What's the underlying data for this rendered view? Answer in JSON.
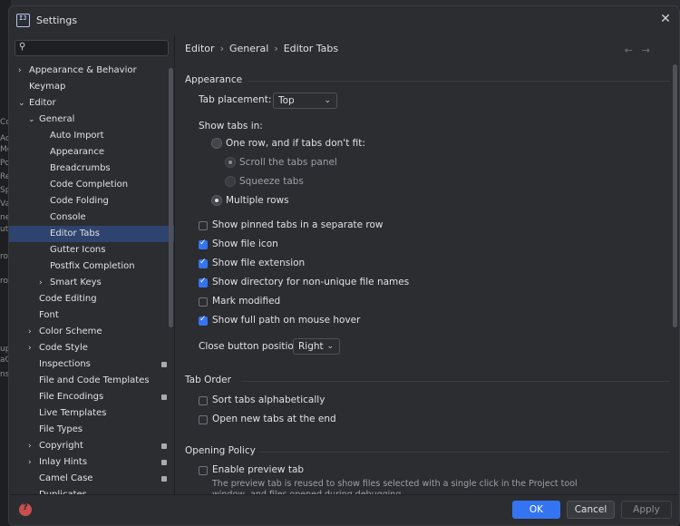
{
  "window": {
    "title": "Settings"
  },
  "background_fragments": [
    "Co",
    "Ac",
    "Mo",
    "Po",
    "Re",
    "Sp",
    "Va",
    "ne",
    "utr",
    "roi",
    "roi",
    "up",
    "aC",
    "ns"
  ],
  "sidebar": {
    "search_placeholder": "",
    "items": [
      {
        "label": "Appearance & Behavior",
        "arrow": "›",
        "indent": 0,
        "bold": true
      },
      {
        "label": "Keymap",
        "arrow": "",
        "indent": 0,
        "bold": true
      },
      {
        "label": "Editor",
        "arrow": "⌄",
        "indent": 0,
        "bold": true
      },
      {
        "label": "General",
        "arrow": "⌄",
        "indent": 1
      },
      {
        "label": "Auto Import",
        "arrow": "",
        "indent": 2
      },
      {
        "label": "Appearance",
        "arrow": "",
        "indent": 2
      },
      {
        "label": "Breadcrumbs",
        "arrow": "",
        "indent": 2
      },
      {
        "label": "Code Completion",
        "arrow": "",
        "indent": 2
      },
      {
        "label": "Code Folding",
        "arrow": "",
        "indent": 2
      },
      {
        "label": "Console",
        "arrow": "",
        "indent": 2
      },
      {
        "label": "Editor Tabs",
        "arrow": "",
        "indent": 2,
        "selected": true
      },
      {
        "label": "Gutter Icons",
        "arrow": "",
        "indent": 2
      },
      {
        "label": "Postfix Completion",
        "arrow": "",
        "indent": 2
      },
      {
        "label": "Smart Keys",
        "arrow": "›",
        "indent": 2
      },
      {
        "label": "Code Editing",
        "arrow": "",
        "indent": 1
      },
      {
        "label": "Font",
        "arrow": "",
        "indent": 1
      },
      {
        "label": "Color Scheme",
        "arrow": "›",
        "indent": 1
      },
      {
        "label": "Code Style",
        "arrow": "›",
        "indent": 1
      },
      {
        "label": "Inspections",
        "arrow": "",
        "indent": 1,
        "badge": true
      },
      {
        "label": "File and Code Templates",
        "arrow": "",
        "indent": 1
      },
      {
        "label": "File Encodings",
        "arrow": "",
        "indent": 1,
        "badge": true
      },
      {
        "label": "Live Templates",
        "arrow": "",
        "indent": 1
      },
      {
        "label": "File Types",
        "arrow": "",
        "indent": 1
      },
      {
        "label": "Copyright",
        "arrow": "›",
        "indent": 1,
        "badge": true
      },
      {
        "label": "Inlay Hints",
        "arrow": "›",
        "indent": 1,
        "badge": true
      },
      {
        "label": "Camel Case",
        "arrow": "",
        "indent": 1,
        "badge": true
      },
      {
        "label": "Duplicates",
        "arrow": "",
        "indent": 1
      }
    ]
  },
  "breadcrumb": [
    "Editor",
    "General",
    "Editor Tabs"
  ],
  "nav": {
    "back": "←",
    "forward": "→"
  },
  "appearance": {
    "title": "Appearance",
    "tab_placement_label": "Tab placement:",
    "tab_placement_value": "Top",
    "show_tabs_in_label": "Show tabs in:",
    "radio_one_row": "One row, and if tabs don't fit:",
    "radio_scroll": "Scroll the tabs panel",
    "radio_squeeze": "Squeeze tabs",
    "radio_multiple": "Multiple rows",
    "checks": [
      {
        "label": "Show pinned tabs in a separate row",
        "checked": false
      },
      {
        "label": "Show file icon",
        "checked": true
      },
      {
        "label": "Show file extension",
        "checked": true
      },
      {
        "label": "Show directory for non-unique file names",
        "checked": true
      },
      {
        "label": "Mark modified",
        "checked": false
      },
      {
        "label": "Show full path on mouse hover",
        "checked": true
      }
    ],
    "close_button_label": "Close button position:",
    "close_button_value": "Right"
  },
  "tab_order": {
    "title": "Tab Order",
    "sort_alpha": "Sort tabs alphabetically",
    "open_at_end": "Open new tabs at the end"
  },
  "opening_policy": {
    "title": "Opening Policy",
    "enable_preview": "Enable preview tab",
    "description": "The preview tab is reused to show files selected with a single click in the Project tool window, and files opened during debugging."
  },
  "buttons": {
    "ok": "OK",
    "cancel": "Cancel",
    "apply": "Apply"
  },
  "colors": {
    "accent": "#3574f0",
    "selection": "#2e436e",
    "background": "#2b2d30",
    "help": "#c94f4f"
  }
}
